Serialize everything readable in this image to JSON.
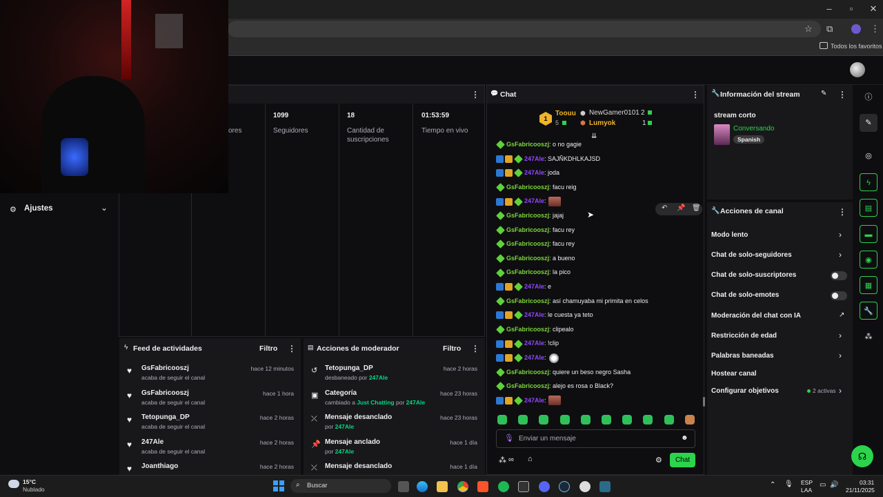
{
  "browser": {
    "bookmarks_folder": "Todos los favoritos"
  },
  "left_nav": {
    "settings_label": "Ajustes"
  },
  "stats": [
    {
      "value": "",
      "label": "ores"
    },
    {
      "value": "1099",
      "label": "Seguidores"
    },
    {
      "value": "18",
      "label": "Cantidad de suscripciones"
    },
    {
      "value": "01:53:59",
      "label": "Tiempo en vivo"
    }
  ],
  "activity_feed": {
    "title": "Feed de actividades",
    "filter": "Filtro",
    "items": [
      {
        "name": "GsFabricooszj",
        "desc": "acaba de seguir el canal",
        "time": "hace 12 minutos"
      },
      {
        "name": "GsFabricooszj",
        "desc": "acaba de seguir el canal",
        "time": "hace 1 hora"
      },
      {
        "name": "Tetopunga_DP",
        "desc": "acaba de seguir el canal",
        "time": "hace 2 horas"
      },
      {
        "name": "247Ale",
        "desc": "acaba de seguir el canal",
        "time": "hace 2 horas"
      },
      {
        "name": "Joanthiago",
        "desc": "",
        "time": "hace 2 horas"
      }
    ]
  },
  "mod_actions": {
    "title": "Acciones de moderador",
    "filter": "Filtro",
    "items": [
      {
        "title": "Tetopunga_DP",
        "pre": "desbaneado por ",
        "who": "247Ale",
        "extra_pre": "",
        "extra": "",
        "time": "hace 2 horas"
      },
      {
        "title": "Categoría",
        "pre": "cambiado a ",
        "who": "Just Chatting",
        "extra_pre": " por ",
        "extra": "247Ale",
        "time": "hace 23 horas"
      },
      {
        "title": "Mensaje desanclado",
        "pre": "por ",
        "who": "247Ale",
        "extra_pre": "",
        "extra": "",
        "time": "hace 23 horas"
      },
      {
        "title": "Mensaje anclado",
        "pre": "por ",
        "who": "247Ale",
        "extra_pre": "",
        "extra": "",
        "time": "hace 1 día"
      },
      {
        "title": "Mensaje desanclado",
        "pre": "",
        "who": "",
        "extra_pre": "",
        "extra": "",
        "time": "hace 1 día"
      }
    ]
  },
  "chat": {
    "title": "Chat",
    "leaderboard": {
      "first_rank": "1",
      "first_name": "Toouu",
      "first_count": "5",
      "second_name": "NewGamer0101",
      "second_count": "2",
      "third_name": "Lumyok",
      "third_count": "1"
    },
    "messages": [
      {
        "user": "GsFabricooszj",
        "badges": "sub",
        "text": ": o no gagie"
      },
      {
        "user": "247Ale",
        "badges": "modvipsub",
        "text": ": SAJÑKDHLKAJSD"
      },
      {
        "user": "247Ale",
        "badges": "modvipsub",
        "text": ": joda"
      },
      {
        "user": "GsFabricooszj",
        "badges": "sub",
        "text": ": facu reig"
      },
      {
        "user": "247Ale",
        "badges": "modvipsub",
        "text": ":",
        "emote": "img"
      },
      {
        "user": "GsFabricooszj",
        "badges": "sub",
        "text": ": jajaj"
      },
      {
        "user": "GsFabricooszj",
        "badges": "sub",
        "text": ": facu rey"
      },
      {
        "user": "GsFabricooszj",
        "badges": "sub",
        "text": ": facu rey"
      },
      {
        "user": "GsFabricooszj",
        "badges": "sub",
        "text": ": a bueno"
      },
      {
        "user": "GsFabricooszj",
        "badges": "sub",
        "text": ": la pico"
      },
      {
        "user": "247Ale",
        "badges": "modvipsub",
        "text": ": e"
      },
      {
        "user": "GsFabricooszj",
        "badges": "sub",
        "text": ": así chamuyaba mi primita en celos"
      },
      {
        "user": "247Ale",
        "badges": "modvipsub",
        "text": ": le cuesta ya teto"
      },
      {
        "user": "GsFabricooszj",
        "badges": "sub",
        "text": ": clipealo"
      },
      {
        "user": "247Ale",
        "badges": "modvipsub",
        "text": ": !clip"
      },
      {
        "user": "247Ale",
        "badges": "modvipsub",
        "text": ":",
        "emote": "dude"
      },
      {
        "user": "GsFabricooszj",
        "badges": "sub",
        "text": ": quiere un beso negro Sasha"
      },
      {
        "user": "GsFabricooszj",
        "badges": "sub",
        "text": ": alejo es rosa o Black?"
      },
      {
        "user": "247Ale",
        "badges": "modvipsub",
        "text": ":",
        "emote": "img"
      }
    ],
    "input_placeholder": "Enviar un mensaje",
    "send_label": "Chat"
  },
  "stream_info": {
    "title": "Información del stream",
    "stream_title": "stream corto",
    "category": "Conversando",
    "language": "Spanish"
  },
  "channel_actions": {
    "title": "Acciones de canal",
    "items": [
      {
        "label": "Modo lento",
        "control": "chevron"
      },
      {
        "label": "Chat de solo-seguidores",
        "control": "chevron"
      },
      {
        "label": "Chat de solo-suscriptores",
        "control": "toggle"
      },
      {
        "label": "Chat de solo-emotes",
        "control": "toggle"
      },
      {
        "label": "Moderación del chat con IA",
        "control": "external"
      },
      {
        "label": "Restricción de edad",
        "control": "chevron"
      },
      {
        "label": "Palabras baneadas",
        "control": "chevron"
      },
      {
        "label": "Hostear canal",
        "control": "none"
      },
      {
        "label": "Configurar objetivos",
        "control": "chevron",
        "note": "2 activas"
      }
    ]
  },
  "taskbar": {
    "weather_temp": "15°C",
    "weather_desc": "Nublado",
    "search_label": "Buscar",
    "lang_top": "ESP",
    "lang_bottom": "LAA",
    "time": "03:31",
    "date": "21/11/2025"
  },
  "colors": {
    "accent_green": "#2bd44c",
    "purple": "#9147ff",
    "sub_green": "#7cd43c"
  }
}
